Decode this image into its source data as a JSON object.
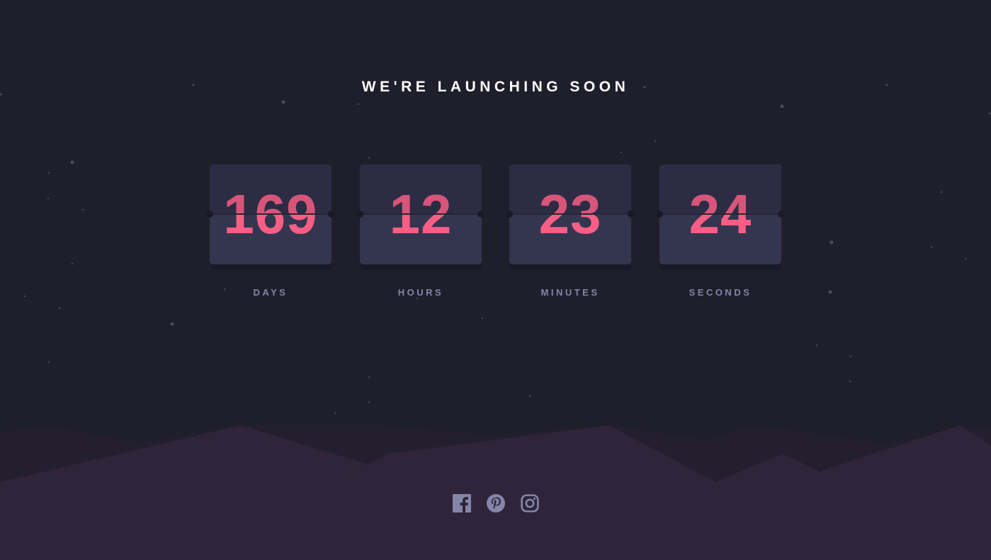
{
  "title": "WE'RE LAUNCHING SOON",
  "countdown": [
    {
      "value": "169",
      "label": "DAYS"
    },
    {
      "value": "12",
      "label": "HOURS"
    },
    {
      "value": "23",
      "label": "MINUTES"
    },
    {
      "value": "24",
      "label": "SECONDS"
    }
  ],
  "social": [
    "facebook-icon",
    "pinterest-icon",
    "instagram-icon"
  ],
  "colors": {
    "background": "#1f1f2b",
    "accent": "#fb5e84",
    "label": "#8385a9",
    "card": "#343650",
    "hills": "#2f2439"
  }
}
